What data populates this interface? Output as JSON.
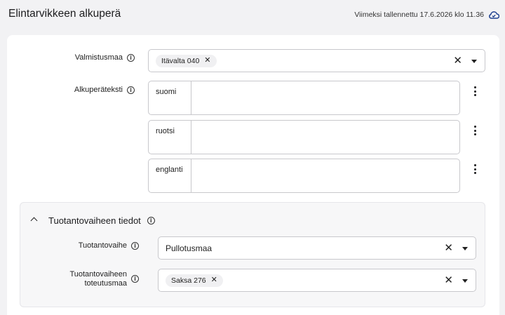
{
  "header": {
    "title": "Elintarvikkeen alkuperä",
    "save_status": "Viimeksi tallennettu 17.6.2026 klo 11.36"
  },
  "fields": {
    "valmistusmaa": {
      "label": "Valmistusmaa",
      "chip": "Itävalta 040"
    },
    "alkuperateksti": {
      "label": "Alkuperäteksti",
      "languages": [
        "suomi",
        "ruotsi",
        "englanti"
      ]
    }
  },
  "section": {
    "title": "Tuotantovaiheen tiedot",
    "tuotantovaihe": {
      "label": "Tuotantovaihe",
      "value": "Pullotusmaa"
    },
    "toteutusmaa": {
      "label_line1": "Tuotantovaiheen",
      "label_line2": "toteutusmaa",
      "chip": "Saksa 276"
    }
  },
  "icons": {
    "info": "info-icon",
    "clear": "close-icon",
    "caret": "caret-down-icon",
    "kebab": "more-vertical-icon",
    "cloud": "cloud-check-icon",
    "collapse": "chevron-up-icon"
  },
  "colors": {
    "background": "#f2f2f4",
    "card": "#ffffff",
    "border": "#c8c8cc",
    "cloud_accent": "#1d3f8f"
  }
}
